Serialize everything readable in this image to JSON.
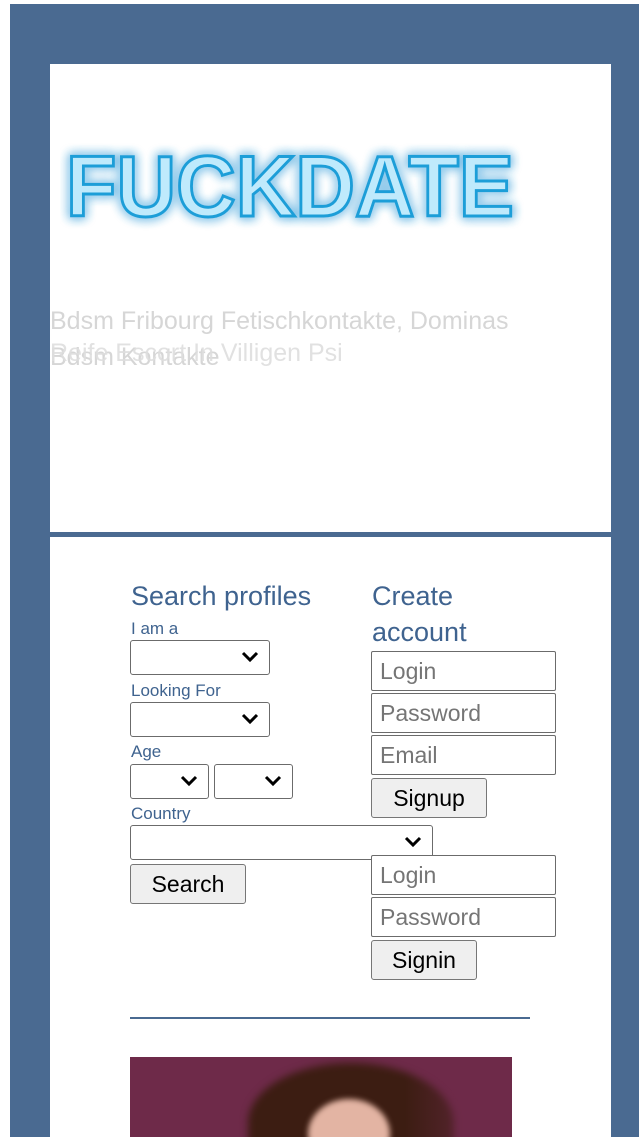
{
  "header": {
    "logo_text": "FUCKDATE",
    "tagline_line1": "Bdsm Fribourg Fetischkontakte, Dominas",
    "tagline_line2": "Bdsm Kontakte",
    "tagline_overlap": "Reife Escort In Villigen Psi"
  },
  "search": {
    "title": "Search profiles",
    "iam_label": "I am a",
    "iam_value": "",
    "looking_label": "Looking For",
    "looking_value": "",
    "age_label": "Age",
    "age_from_value": "",
    "age_to_value": "",
    "country_label": "Country",
    "country_value": "",
    "search_button": "Search"
  },
  "create_account": {
    "title_line1": "Create",
    "title_line2": "account",
    "login_placeholder": "Login",
    "password_placeholder": "Password",
    "email_placeholder": "Email",
    "signup_button": "Signup"
  },
  "signin": {
    "login_placeholder": "Login",
    "password_placeholder": "Password",
    "signin_button": "Signin"
  },
  "icons": {
    "dropdown": "chevron-down-icon"
  },
  "colors": {
    "frame": "#4a6a91",
    "heading": "#3f638f",
    "logo_glow": "#36b8f0"
  }
}
